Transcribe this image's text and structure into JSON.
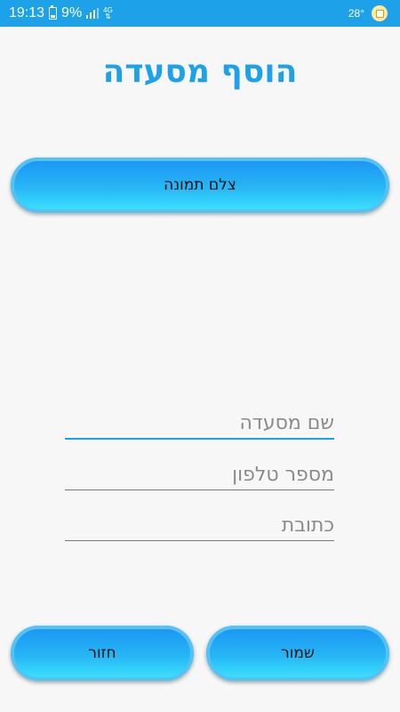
{
  "status_bar": {
    "time": "19:13",
    "battery": "9%",
    "network": "4G",
    "temperature": "28°",
    "icons": [
      "battery-icon",
      "signal-icon",
      "network-4g-icon",
      "calendar-icon"
    ]
  },
  "screen": {
    "title": "הוסף מסעדה"
  },
  "buttons": {
    "take_photo": "צלם תמונה",
    "save": "שמור",
    "back": "חזור"
  },
  "fields": {
    "name_placeholder": "שם מסעדה",
    "phone_placeholder": "מספר טלפון",
    "address_placeholder": "כתובת"
  },
  "colors": {
    "status_bar": "#1da1e8",
    "title": "#1da1e8",
    "button_top": "#1a93f2",
    "button_bottom": "#3ee6ff",
    "active_underline": "#1da1e8",
    "background": "#f7f7f8"
  }
}
